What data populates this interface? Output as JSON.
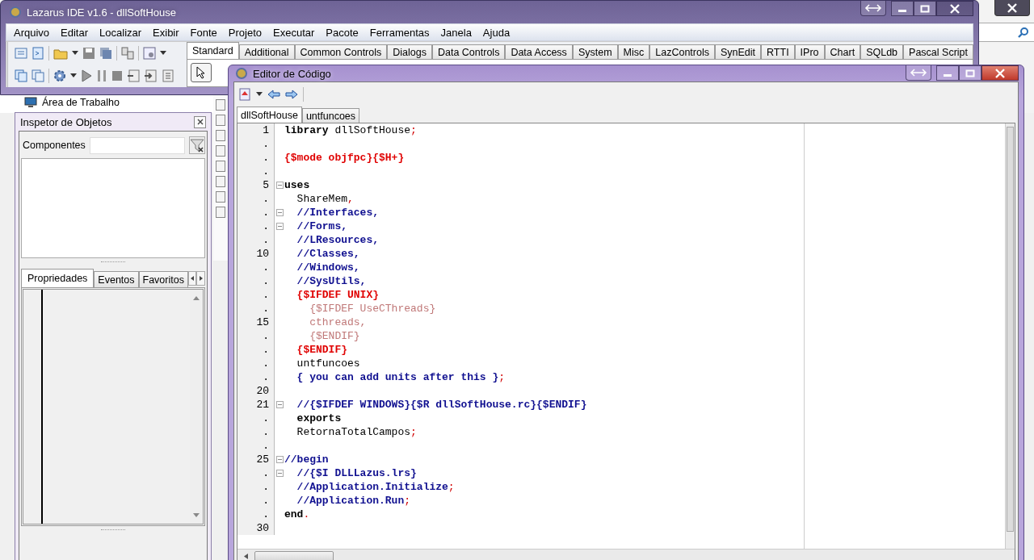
{
  "desktop_item": {
    "label": "Área de Trabalho"
  },
  "main_window": {
    "title": "Lazarus IDE v1.6 - dllSoftHouse",
    "menu": [
      "Arquivo",
      "Editar",
      "Localizar",
      "Exibir",
      "Fonte",
      "Projeto",
      "Executar",
      "Pacote",
      "Ferramentas",
      "Janela",
      "Ajuda"
    ],
    "palette_tabs": [
      {
        "label": "Standard",
        "selected": true
      },
      {
        "label": "Additional",
        "selected": false
      },
      {
        "label": "Common Controls",
        "selected": false
      },
      {
        "label": "Dialogs",
        "selected": false
      },
      {
        "label": "Data Controls",
        "selected": false
      },
      {
        "label": "Data Access",
        "selected": false
      },
      {
        "label": "System",
        "selected": false
      },
      {
        "label": "Misc",
        "selected": false
      },
      {
        "label": "LazControls",
        "selected": false
      },
      {
        "label": "SynEdit",
        "selected": false
      },
      {
        "label": "RTTI",
        "selected": false
      },
      {
        "label": "IPro",
        "selected": false
      },
      {
        "label": "Chart",
        "selected": false
      },
      {
        "label": "SQLdb",
        "selected": false
      },
      {
        "label": "Pascal Script",
        "selected": false
      }
    ]
  },
  "object_inspector": {
    "title": "Inspetor de Objetos",
    "components_label": "Componentes",
    "tabs": [
      {
        "label": "Propriedades",
        "selected": true
      },
      {
        "label": "Eventos",
        "selected": false
      },
      {
        "label": "Favoritos",
        "selected": false
      }
    ]
  },
  "editor": {
    "title": "Editor de Código",
    "tabs": [
      {
        "label": "dllSoftHouse",
        "selected": true
      },
      {
        "label": "untfuncoes",
        "selected": false
      }
    ],
    "lines": [
      {
        "number": "1",
        "fold": false,
        "parts": [
          {
            "kind": "keyword",
            "text": "library"
          },
          {
            "kind": "plain",
            "text": " dllSoftHouse"
          },
          {
            "kind": "symbol",
            "text": ";"
          }
        ]
      },
      {
        "number": ".",
        "fold": false
      },
      {
        "number": ".",
        "fold": false,
        "parts": [
          {
            "kind": "directive",
            "text": "{$mode objfpc}{$H+}"
          }
        ]
      },
      {
        "number": ".",
        "fold": false
      },
      {
        "number": "5",
        "fold": true,
        "parts": [
          {
            "kind": "keyword",
            "text": "uses"
          }
        ]
      },
      {
        "number": ".",
        "fold": false,
        "parts": [
          {
            "kind": "plain",
            "text": "  ShareMem"
          },
          {
            "kind": "symbol",
            "text": ","
          }
        ]
      },
      {
        "number": ".",
        "fold": true,
        "parts": [
          {
            "kind": "comment",
            "text": "  //Interfaces,"
          }
        ]
      },
      {
        "number": ".",
        "fold": true,
        "parts": [
          {
            "kind": "comment",
            "text": "  //Forms,"
          }
        ]
      },
      {
        "number": ".",
        "fold": false,
        "parts": [
          {
            "kind": "comment",
            "text": "  //LResources,"
          }
        ]
      },
      {
        "number": "10",
        "fold": false,
        "parts": [
          {
            "kind": "comment",
            "text": "  //Classes,"
          }
        ]
      },
      {
        "number": ".",
        "fold": false,
        "parts": [
          {
            "kind": "comment",
            "text": "  //Windows,"
          }
        ]
      },
      {
        "number": ".",
        "fold": false,
        "parts": [
          {
            "kind": "comment",
            "text": "  //SysUtils,"
          }
        ]
      },
      {
        "number": ".",
        "fold": false,
        "parts": [
          {
            "kind": "directive",
            "text": "  {$IFDEF UNIX}"
          }
        ]
      },
      {
        "number": ".",
        "fold": false,
        "parts": [
          {
            "kind": "inactive",
            "text": "    {$IFDEF UseCThreads}"
          }
        ]
      },
      {
        "number": "15",
        "fold": false,
        "parts": [
          {
            "kind": "inactive",
            "text": "    cthreads,"
          }
        ]
      },
      {
        "number": ".",
        "fold": false,
        "parts": [
          {
            "kind": "inactive",
            "text": "    {$ENDIF}"
          }
        ]
      },
      {
        "number": ".",
        "fold": false,
        "parts": [
          {
            "kind": "directive",
            "text": "  {$ENDIF}"
          }
        ]
      },
      {
        "number": ".",
        "fold": false,
        "parts": [
          {
            "kind": "plain",
            "text": "  untfuncoes"
          }
        ]
      },
      {
        "number": ".",
        "fold": false,
        "parts": [
          {
            "kind": "comment",
            "text": "  { you can add units after this }"
          },
          {
            "kind": "symbol",
            "text": ";"
          }
        ]
      },
      {
        "number": "20",
        "fold": false
      },
      {
        "number": "21",
        "fold": true,
        "parts": [
          {
            "kind": "comment",
            "text": "  //{$IFDEF WINDOWS}{$R dllSoftHouse.rc}{$ENDIF}"
          }
        ]
      },
      {
        "number": ".",
        "fold": false,
        "parts": [
          {
            "kind": "keyword",
            "text": "  exports"
          }
        ]
      },
      {
        "number": ".",
        "fold": false,
        "parts": [
          {
            "kind": "plain",
            "text": "  RetornaTotalCampos"
          },
          {
            "kind": "symbol",
            "text": ";"
          }
        ]
      },
      {
        "number": ".",
        "fold": false
      },
      {
        "number": "25",
        "fold": true,
        "parts": [
          {
            "kind": "comment",
            "text": "//begin"
          }
        ]
      },
      {
        "number": ".",
        "fold": true,
        "parts": [
          {
            "kind": "comment",
            "text": "  //{$I DLLLazus.lrs}"
          }
        ]
      },
      {
        "number": ".",
        "fold": false,
        "parts": [
          {
            "kind": "comment",
            "text": "  //Application.Initialize"
          },
          {
            "kind": "symbol",
            "text": ";"
          }
        ]
      },
      {
        "number": ".",
        "fold": false,
        "parts": [
          {
            "kind": "comment",
            "text": "  //Application.Run"
          },
          {
            "kind": "symbol",
            "text": ";"
          }
        ]
      },
      {
        "number": ".",
        "fold": false,
        "parts": [
          {
            "kind": "keyword",
            "text": "end"
          },
          {
            "kind": "symbol",
            "text": "."
          }
        ]
      },
      {
        "number": "30",
        "fold": false
      }
    ]
  }
}
